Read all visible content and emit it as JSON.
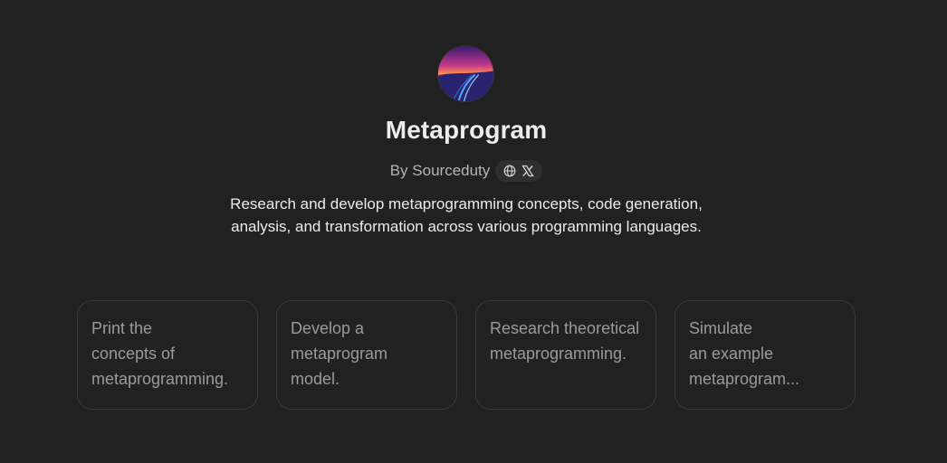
{
  "gpt": {
    "name": "Metaprogram",
    "byline": "By Sourceduty",
    "description": "Research and develop metaprogramming concepts, code generation, analysis, and transformation across various programming languages.",
    "icons": [
      "globe-icon",
      "x-logo-icon"
    ]
  },
  "starters": [
    {
      "label": "Print the\nconcepts of\nmetaprogramming."
    },
    {
      "label": "Develop a\nmetaprogram\nmodel."
    },
    {
      "label": "Research theoretical\nmetaprogramming."
    },
    {
      "label": "Simulate\nan example\nmetaprogram..."
    }
  ],
  "colors": {
    "background": "#212121",
    "text": "#ececec",
    "muted": "#b4b4b4",
    "card_border": "#3a3a3a",
    "card_text": "#9b9b9b"
  }
}
